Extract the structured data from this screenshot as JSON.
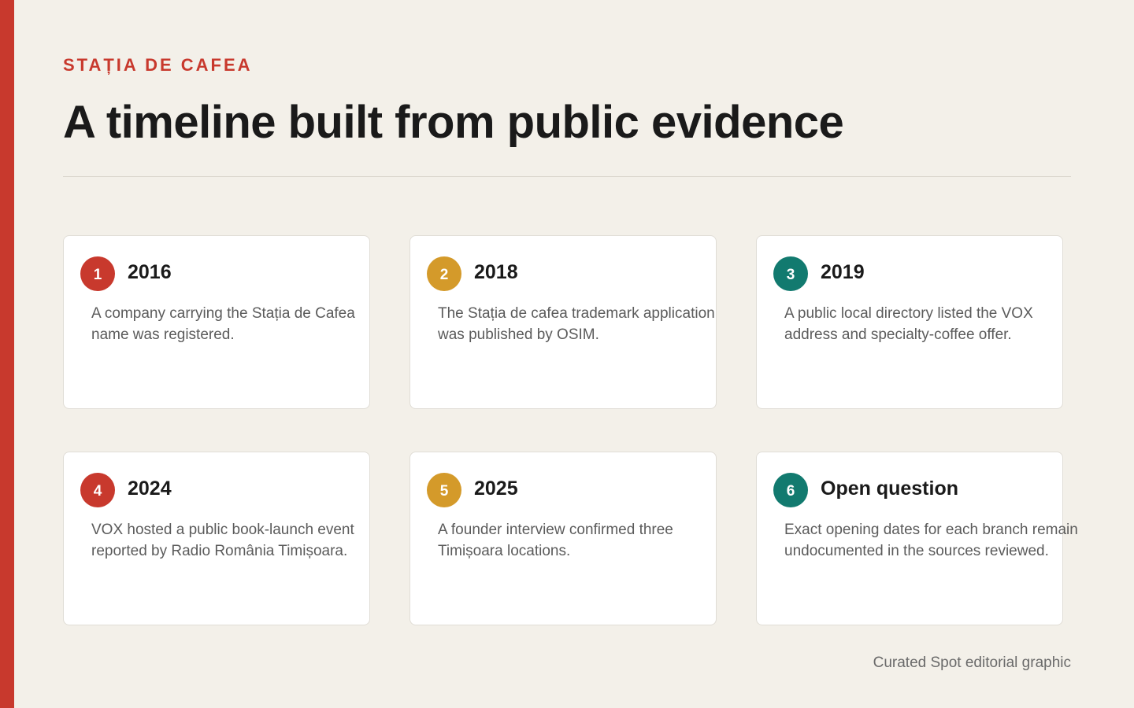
{
  "header": {
    "eyebrow": "STAȚIA DE CAFEA",
    "title": "A timeline built from public evidence"
  },
  "colors": {
    "accent": "#c8392d",
    "red": "#c8392d",
    "gold": "#d49a2a",
    "teal": "#127a6f"
  },
  "timeline": [
    {
      "number": "1",
      "heading": "2016",
      "color": "#c8392d",
      "text": "A company carrying the Stația de Cafea name was registered."
    },
    {
      "number": "2",
      "heading": "2018",
      "color": "#d49a2a",
      "text": "The Stația de cafea trademark application was published by OSIM."
    },
    {
      "number": "3",
      "heading": "2019",
      "color": "#127a6f",
      "text": "A public local directory listed the VOX address and specialty-coffee offer."
    },
    {
      "number": "4",
      "heading": "2024",
      "color": "#c8392d",
      "text": "VOX hosted a public book-launch event reported by Radio România Timișoara."
    },
    {
      "number": "5",
      "heading": "2025",
      "color": "#d49a2a",
      "text": "A founder interview confirmed three Timișoara locations."
    },
    {
      "number": "6",
      "heading": "Open question",
      "color": "#127a6f",
      "text": "Exact opening dates for each branch remain undocumented in the sources reviewed."
    }
  ],
  "footer": {
    "credit": "Curated Spot editorial graphic"
  }
}
